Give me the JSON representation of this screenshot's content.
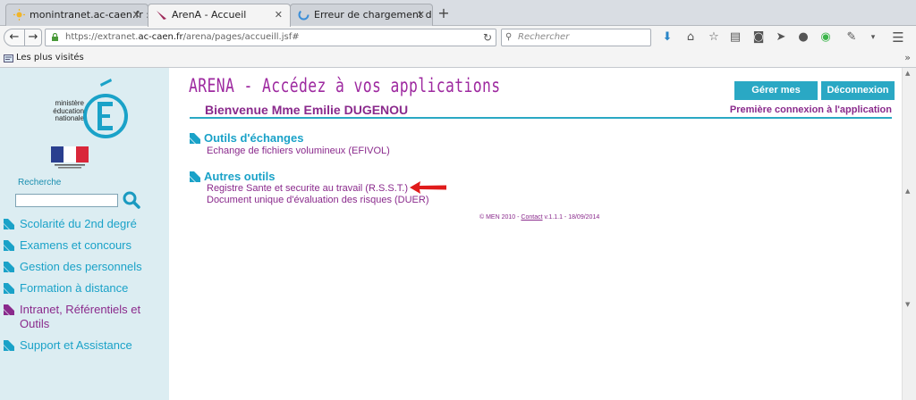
{
  "browser": {
    "tabs": [
      {
        "title": "monintranet.ac-caen.fr :: A...",
        "active": false
      },
      {
        "title": "ArenA - Accueil",
        "active": true
      },
      {
        "title": "Erreur de chargement de la...",
        "active": false
      }
    ],
    "new_tab": "+",
    "url_prefix": "https://extranet.",
    "url_domain": "ac-caen.fr",
    "url_suffix": "/arena/pages/accueill.jsf#",
    "search_placeholder": "Rechercher",
    "bookmarks_label": "Les plus visités",
    "bookmarks_more": "»"
  },
  "sidebar": {
    "logo_text": [
      "ministère",
      "éducation",
      "nationale"
    ],
    "search_label": "Recherche",
    "search_value": "",
    "menu": [
      {
        "label": "Scolarité du 2nd degré",
        "color": "#1aa2c8"
      },
      {
        "label": "Examens et concours",
        "color": "#1aa2c8"
      },
      {
        "label": "Gestion des personnels",
        "color": "#1aa2c8"
      },
      {
        "label": "Formation à distance",
        "color": "#1aa2c8"
      },
      {
        "label": "Intranet, Référentiels et Outils",
        "color": "#8a2a8c"
      },
      {
        "label": "Support et Assistance",
        "color": "#1aa2c8"
      }
    ]
  },
  "header": {
    "app_title": "ARENA - Accédez à vos applications",
    "welcome": "Bienvenue Mme Emilie DUGENOU",
    "btn_favoris": "Gérer mes favoris",
    "btn_deconnexion": "Déconnexion",
    "first_connection": "Première connexion à l'application"
  },
  "sections": [
    {
      "title": "Outils d'échanges",
      "links": [
        "Echange de fichiers volumineux (EFIVOL)"
      ]
    },
    {
      "title": "Autres outils",
      "links": [
        "Registre Sante et securite au travail (R.S.S.T.)",
        "Document unique d'évaluation des risques (DUER)"
      ]
    }
  ],
  "footer": {
    "prefix": "© MEN 2010 - ",
    "contact": "Contact",
    "suffix": " v.1.1.1 - 18/09/2014"
  },
  "colors": {
    "accent": "#2aa8c4",
    "purple": "#8a2a8c",
    "teal_text": "#1aa2c8",
    "sidebar_bg": "#dcedf2"
  }
}
